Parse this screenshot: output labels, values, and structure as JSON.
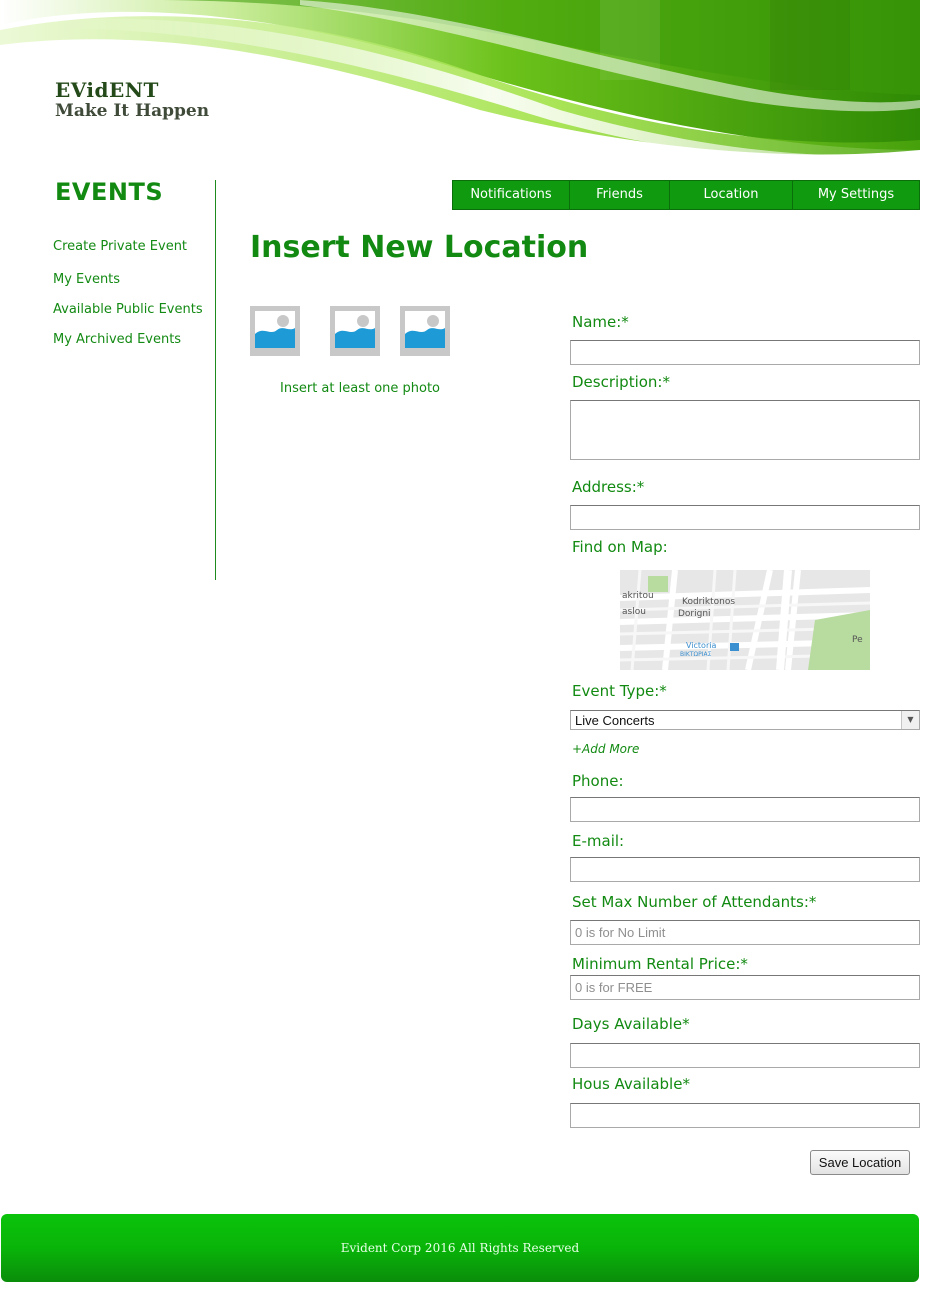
{
  "brand": {
    "name": "EVidENT",
    "tagline": "Make It Happen"
  },
  "sidebar": {
    "title": "EVENTS",
    "items": [
      {
        "label": "Create Private Event"
      },
      {
        "label": "My Events"
      },
      {
        "label": "Available Public Events"
      },
      {
        "label": "My Archived Events"
      }
    ]
  },
  "nav": {
    "items": [
      {
        "label": "Notifications"
      },
      {
        "label": "Friends"
      },
      {
        "label": "Location"
      },
      {
        "label": "My Settings"
      }
    ]
  },
  "page": {
    "title": "Insert New Location"
  },
  "photos": {
    "hint": "Insert at least one photo",
    "icon": "image-placeholder-icon"
  },
  "form": {
    "name_label": "Name:*",
    "description_label": "Description:*",
    "address_label": "Address:*",
    "map_label": "Find on Map:",
    "map_streets": [
      "Kodriktonos",
      "Dorigni",
      "akritou",
      "aslou",
      "Victoria",
      "ΒΙΚΤΩΡΙΑΣ",
      "Pe"
    ],
    "event_type_label": "Event Type:*",
    "event_type_value": "Live Concerts",
    "add_more": "+Add More",
    "phone_label": "Phone:",
    "email_label": "E-mail:",
    "max_attendants_label": "Set Max Number of Attendants:*",
    "max_attendants_placeholder": "0 is for No Limit",
    "min_price_label": "Minimum Rental Price:*",
    "min_price_placeholder": "0 is for FREE",
    "days_label": "Days Available*",
    "hours_label": "Hous Available*",
    "save_label": "Save Location"
  },
  "footer": {
    "text": "Evident Corp  2016 All Rights Reserved"
  },
  "colors": {
    "accent": "#128a12",
    "nav": "#0f9a0f",
    "footer": "#09b409"
  }
}
